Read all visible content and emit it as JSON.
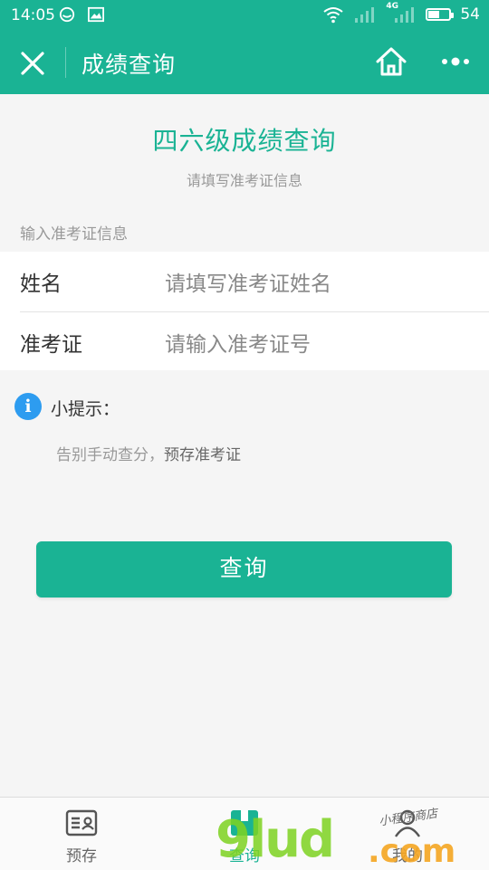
{
  "status_bar": {
    "time": "14:05",
    "battery": "54",
    "battery_level": 0.54,
    "network": "4G"
  },
  "nav": {
    "title": "成绩查询"
  },
  "header": {
    "title": "四六级成绩查询",
    "subtitle": "请填写准考证信息"
  },
  "form": {
    "section_label": "输入准考证信息",
    "fields": [
      {
        "label": "姓名",
        "placeholder": "请填写准考证姓名"
      },
      {
        "label": "准考证",
        "placeholder": "请输入准考证号"
      }
    ]
  },
  "tip": {
    "icon_text": "i",
    "title": "小提示：",
    "text_prefix": "告别手动查分，",
    "text_accent": "预存准考证"
  },
  "query_button": {
    "label": "查询"
  },
  "tabbar": {
    "items": [
      {
        "label": "预存",
        "icon": "id-card-icon",
        "active": false
      },
      {
        "label": "查询",
        "icon": "book-icon",
        "active": true
      },
      {
        "label": "我的",
        "icon": "user-icon",
        "active": false
      }
    ]
  },
  "watermark": {
    "logo": "9lud",
    "domain": ".com",
    "caption": "小程序商店"
  },
  "colors": {
    "brand": "#1ab394",
    "info": "#2d9cf0",
    "background": "#f5f5f5"
  }
}
